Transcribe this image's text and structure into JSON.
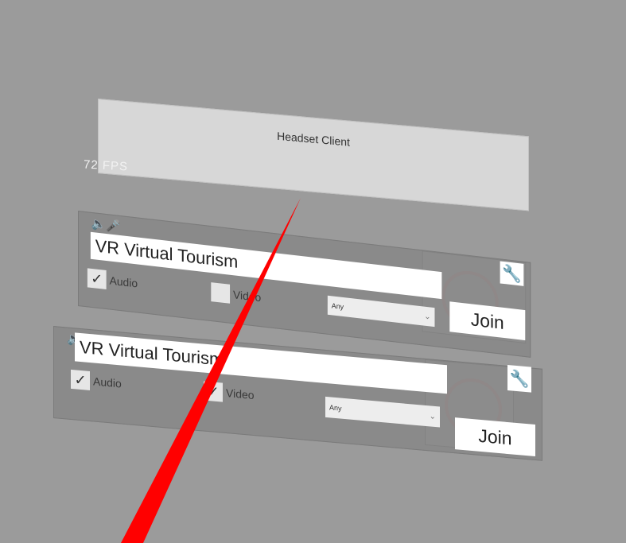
{
  "header": {
    "title": "Headset Client",
    "fps": "72 FPS"
  },
  "rooms": [
    {
      "name": "VR Virtual Tourism",
      "audio_label": "Audio",
      "audio_checked": true,
      "video_label": "Video",
      "video_checked": false,
      "stream_select": "Any",
      "join_label": "Join"
    },
    {
      "name": "VR Virtual Tourism",
      "audio_label": "Audio",
      "audio_checked": true,
      "video_label": "Video",
      "video_checked": true,
      "stream_select": "Any",
      "join_label": "Join"
    }
  ],
  "icons": {
    "settings": "wrench-icon",
    "preview_placeholder": "no-video-icon",
    "room_status": "speaker-mic-icon"
  },
  "colors": {
    "background": "#9b9b9b",
    "panel": "#8a8a8a",
    "laser": "#ff0000"
  }
}
